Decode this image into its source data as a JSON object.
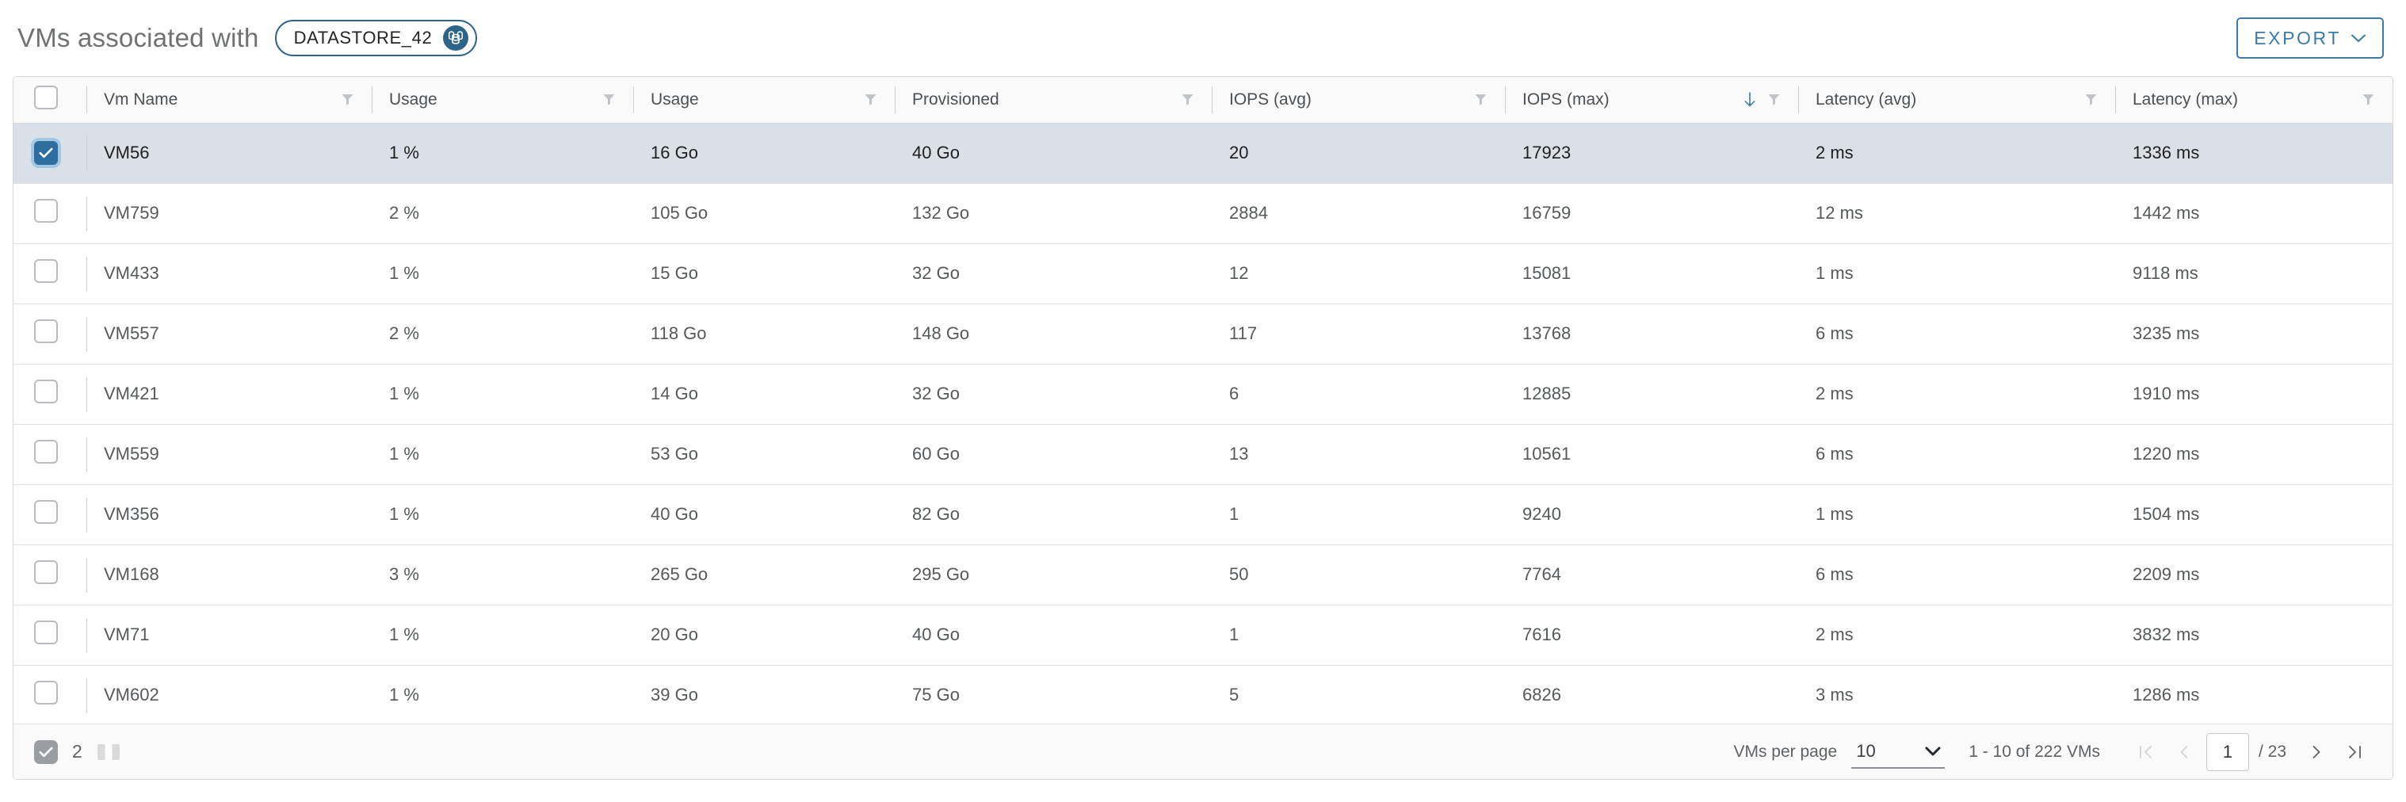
{
  "header": {
    "title": "VMs associated with",
    "chip": {
      "label": "DATASTORE_42",
      "icon": "datastore-icon"
    },
    "export": {
      "label": "EXPORT",
      "chevron_icon": "chevron-down-icon"
    }
  },
  "table": {
    "select_all_checked": false,
    "columns": [
      {
        "label": "Vm Name",
        "filter_icon": "filter-icon",
        "sorted": false,
        "sort_dir": ""
      },
      {
        "label": "Usage",
        "filter_icon": "filter-icon",
        "sorted": false,
        "sort_dir": ""
      },
      {
        "label": "Usage",
        "filter_icon": "filter-icon",
        "sorted": false,
        "sort_dir": ""
      },
      {
        "label": "Provisioned",
        "filter_icon": "filter-icon",
        "sorted": false,
        "sort_dir": ""
      },
      {
        "label": "IOPS (avg)",
        "filter_icon": "filter-icon",
        "sorted": false,
        "sort_dir": ""
      },
      {
        "label": "IOPS (max)",
        "filter_icon": "filter-icon",
        "sorted": true,
        "sort_dir": "desc"
      },
      {
        "label": "Latency (avg)",
        "filter_icon": "filter-icon",
        "sorted": false,
        "sort_dir": ""
      },
      {
        "label": "Latency (max)",
        "filter_icon": "filter-icon",
        "sorted": false,
        "sort_dir": ""
      }
    ],
    "rows": [
      {
        "selected": true,
        "vm_name": "VM56",
        "usage_pct": "1 %",
        "usage_go": "16 Go",
        "provisioned": "40 Go",
        "iops_avg": "20",
        "iops_max": "17923",
        "latency_avg": "2 ms",
        "latency_max": "1336 ms"
      },
      {
        "selected": false,
        "vm_name": "VM759",
        "usage_pct": "2 %",
        "usage_go": "105 Go",
        "provisioned": "132 Go",
        "iops_avg": "2884",
        "iops_max": "16759",
        "latency_avg": "12 ms",
        "latency_max": "1442 ms"
      },
      {
        "selected": false,
        "vm_name": "VM433",
        "usage_pct": "1 %",
        "usage_go": "15 Go",
        "provisioned": "32 Go",
        "iops_avg": "12",
        "iops_max": "15081",
        "latency_avg": "1 ms",
        "latency_max": "9118 ms"
      },
      {
        "selected": false,
        "vm_name": "VM557",
        "usage_pct": "2 %",
        "usage_go": "118 Go",
        "provisioned": "148 Go",
        "iops_avg": "117",
        "iops_max": "13768",
        "latency_avg": "6 ms",
        "latency_max": "3235 ms"
      },
      {
        "selected": false,
        "vm_name": "VM421",
        "usage_pct": "1 %",
        "usage_go": "14 Go",
        "provisioned": "32 Go",
        "iops_avg": "6",
        "iops_max": "12885",
        "latency_avg": "2 ms",
        "latency_max": "1910 ms"
      },
      {
        "selected": false,
        "vm_name": "VM559",
        "usage_pct": "1 %",
        "usage_go": "53 Go",
        "provisioned": "60 Go",
        "iops_avg": "13",
        "iops_max": "10561",
        "latency_avg": "6 ms",
        "latency_max": "1220 ms"
      },
      {
        "selected": false,
        "vm_name": "VM356",
        "usage_pct": "1 %",
        "usage_go": "40 Go",
        "provisioned": "82 Go",
        "iops_avg": "1",
        "iops_max": "9240",
        "latency_avg": "1 ms",
        "latency_max": "1504 ms"
      },
      {
        "selected": false,
        "vm_name": "VM168",
        "usage_pct": "3 %",
        "usage_go": "265 Go",
        "provisioned": "295 Go",
        "iops_avg": "50",
        "iops_max": "7764",
        "latency_avg": "6 ms",
        "latency_max": "2209 ms"
      },
      {
        "selected": false,
        "vm_name": "VM71",
        "usage_pct": "1 %",
        "usage_go": "20 Go",
        "provisioned": "40 Go",
        "iops_avg": "1",
        "iops_max": "7616",
        "latency_avg": "2 ms",
        "latency_max": "3832 ms"
      },
      {
        "selected": false,
        "vm_name": "VM602",
        "usage_pct": "1 %",
        "usage_go": "39 Go",
        "provisioned": "75 Go",
        "iops_avg": "5",
        "iops_max": "6826",
        "latency_avg": "3 ms",
        "latency_max": "1286 ms"
      }
    ]
  },
  "footer": {
    "selection_checkbox_checked": true,
    "selected_count": "2",
    "columns_icon": "columns-layout-icon",
    "per_page_label": "VMs per page",
    "per_page_value": "10",
    "per_page_chevron_icon": "chevron-down-icon",
    "range_text": "1 - 10 of 222 VMs",
    "pager": {
      "first_icon": "first-page-icon",
      "prev_icon": "previous-page-icon",
      "current_page": "1",
      "total_pages": "/ 23",
      "next_icon": "next-page-icon",
      "last_icon": "last-page-icon"
    }
  },
  "colors": {
    "accent": "#3c7ba5",
    "chip_border": "#2d6488",
    "selected_row": "#d9e0e7",
    "checkbox_checked": "#2d6e9e"
  }
}
